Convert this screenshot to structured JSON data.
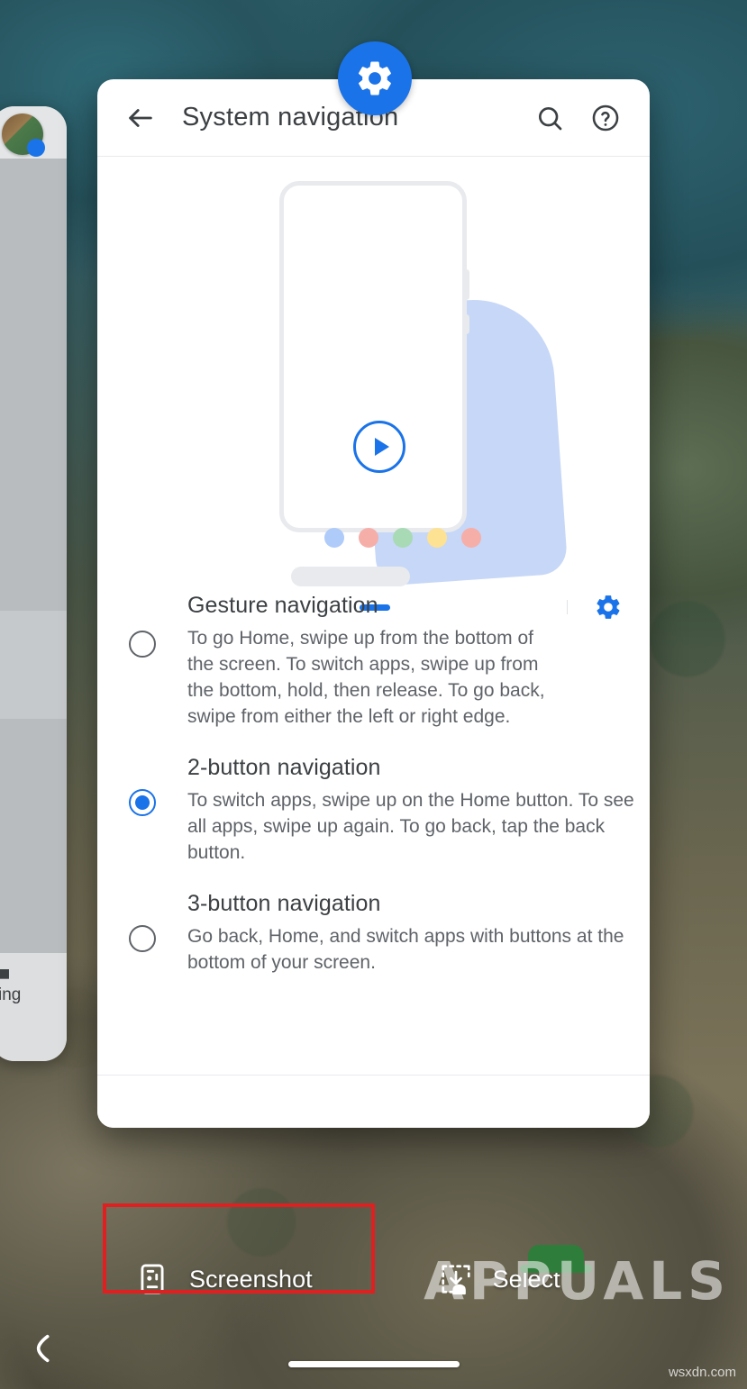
{
  "dialog": {
    "title": "System navigation",
    "back_icon": "arrow-left-icon",
    "search_icon": "search-icon",
    "help_icon": "help-circle-icon",
    "badge_icon": "settings-gear-icon",
    "illustration": {
      "play_icon": "play-circle-icon",
      "dot_colors": [
        "#aecbfa",
        "#f6aea9",
        "#a8dab5",
        "#fde293",
        "#f6aea9"
      ]
    },
    "options": [
      {
        "title": "Gesture navigation",
        "description": "To go Home, swipe up from the bottom of the screen. To switch apps, swipe up from the bottom, hold, then release. To go back, swipe from either the left or right edge.",
        "selected": false,
        "settings_icon": "settings-gear-icon",
        "has_settings": true
      },
      {
        "title": "2-button navigation",
        "description": "To switch apps, swipe up on the Home button. To see all apps, swipe up again. To go back, tap the back button.",
        "selected": true,
        "has_settings": false
      },
      {
        "title": "3-button navigation",
        "description": "Go back, Home, and switch apps with buttons at the bottom of your screen.",
        "selected": false,
        "has_settings": false
      }
    ]
  },
  "recents_card": {
    "app_icon": "map-app-icon",
    "footer_icon": "briefcase-icon",
    "footer_label": "ing"
  },
  "actionbar": {
    "screenshot": {
      "label": "Screenshot",
      "icon": "phone-screenshot-icon"
    },
    "select": {
      "label": "Select",
      "icon": "select-cursor-icon"
    },
    "highlight_color": "#e02020"
  },
  "navbar": {
    "back_icon": "back-gesture-icon",
    "home_indicator": "home-pill"
  },
  "watermark": {
    "brand": "APPUALS",
    "small": "wsxdn.com"
  },
  "colors": {
    "accent": "#1a73e8",
    "text_primary": "#3c4043",
    "text_secondary": "#5f6368"
  }
}
